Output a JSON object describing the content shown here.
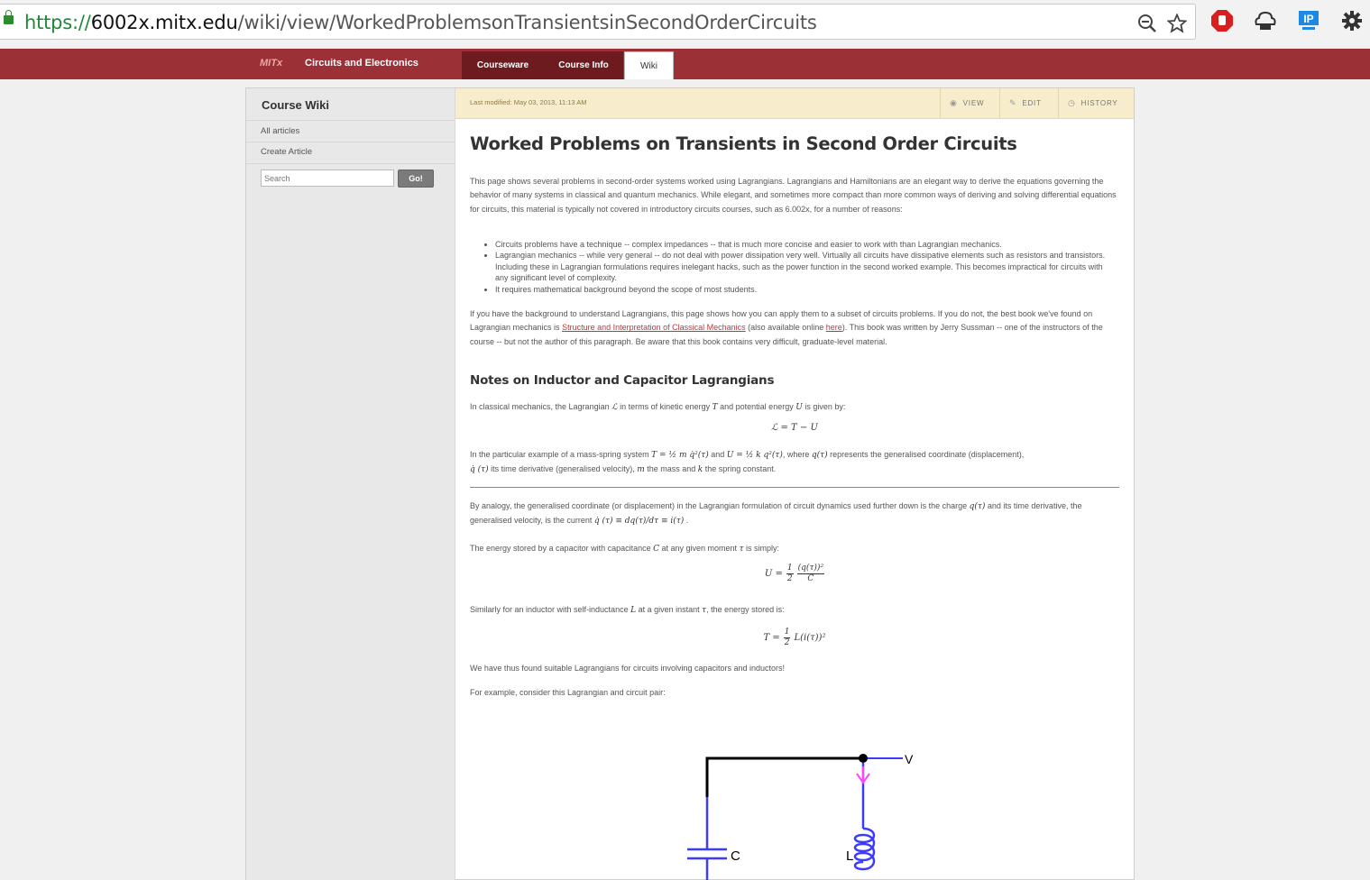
{
  "browser": {
    "url_scheme": "https://",
    "url_host": "6002x.mitx.edu",
    "url_path": "/wiki/view/WorkedProblemsonTransientsinSecondOrderCircuits",
    "ext_ip_label": "IP"
  },
  "header": {
    "brand": "MITx",
    "course_title": "Circuits and Electronics",
    "tabs": [
      "Courseware",
      "Course Info",
      "Wiki"
    ]
  },
  "sidebar": {
    "title": "Course Wiki",
    "links": [
      "All articles",
      "Create Article"
    ],
    "search_placeholder": "Search",
    "go_label": "Go!"
  },
  "toolbar": {
    "last_modified": "Last modified: May 03, 2013, 11:13 AM",
    "view": "VIEW",
    "edit": "EDIT",
    "history": "HISTORY"
  },
  "article": {
    "title": "Worked Problems on Transients in Second Order Circuits",
    "intro": "This page shows several problems in second-order systems worked using Lagrangians. Lagrangians and Hamiltonians are an elegant way to derive the equations governing the behavior of many systems in classical and quantum mechanics. While elegant, and sometimes more compact than more common ways of deriving and solving differential equations for circuits, this material is typically not covered in introductory circuits courses, such as 6.002x, for a number of reasons:",
    "bullets": [
      "Circuits problems have a technique -- complex impedances -- that is much more concise and easier to work with than Lagrangian mechanics.",
      "Lagrangian mechanics -- while very general -- do not deal with power dissipation very well. Virtually all circuits have dissipative elements such as resistors and transistors. Including these in Lagrangian formulations requires inelegant hacks, such as the power function in the second worked example. This becomes impractical for circuits with any significant level of complexity.",
      "It requires mathematical background beyond the scope of most students."
    ],
    "para2_a": "If you have the background to understand Lagrangians, this page shows how you can apply them to a subset of circuits problems. If you do not, the best book we've found on Lagrangian mechanics is ",
    "para2_link1": "Structure and Interpretation of Classical Mechanics",
    "para2_b": " (also available online ",
    "para2_link2": "here",
    "para2_c": "). This book was written by Jerry Sussman -- one of the instructors of the course -- but not the author of this paragraph. Be aware that this book contains very difficult, graduate-level material.",
    "section_title": "Notes on Inductor and Capacitor Lagrangians",
    "lag_a": "In classical mechanics, the Lagrangian ",
    "lag_b": " in terms of kinetic energy ",
    "lag_c": " and potential energy ",
    "lag_d": " is given by:",
    "eq_lagrangian": "ℒ = T − U",
    "mass_a": "In the particular example of a mass-spring system ",
    "mass_eq1": "T = ½ m q̇²(τ)",
    "mass_b": " and ",
    "mass_eq2": "U = ½ k q²(τ)",
    "mass_c": ", where ",
    "mass_q": "q(τ)",
    "mass_d": " represents the generalised coordinate (displacement),",
    "mass_qdot": "q̇ (τ)",
    "mass_e": " its time derivative (generalised velocity), ",
    "mass_m": "m",
    "mass_f": " the mass and ",
    "mass_k": "k",
    "mass_g": " the spring constant.",
    "analogy_a": "By analogy, the generalised coordinate (or displacement) in the Lagrangian formulation of circuit dynamics used further down is the charge ",
    "analogy_q": "q(τ)",
    "analogy_b": " and its time derivative, the generalised velocity, is the current ",
    "analogy_eq": "q̇ (τ) ≡ dq(τ)/dτ ≡ i(τ)",
    "analogy_c": " .",
    "cap_a": "The energy stored by a capacitor with capacitance ",
    "cap_C": "C",
    "cap_b": " at any given moment ",
    "cap_tau": "τ",
    "cap_c": " is simply:",
    "eq_cap_lhs": "U =",
    "eq_cap_half": "1",
    "eq_cap_two": "2",
    "eq_cap_num": "(q(τ))²",
    "eq_cap_den": "C",
    "ind_a": "Similarly for an inductor with self-inductance ",
    "ind_L": "L",
    "ind_b": " at a given instant ",
    "ind_tau": "τ",
    "ind_c": ", the energy stored is:",
    "eq_ind_lhs": "T =",
    "eq_ind_rhs": "L(i(τ))²",
    "found": "We have thus found suitable Lagrangians for circuits involving capacitors and inductors!",
    "example": "For example, consider this Lagrangian and circuit pair:",
    "symbols": {
      "L": "ℒ",
      "T": "T",
      "U": "U"
    }
  },
  "circuit": {
    "label_v": "V",
    "label_c": "C",
    "label_l": "L"
  },
  "colors": {
    "header": "#9b3036",
    "tab_dark": "#6e1b20",
    "modbar": "#f7eccb",
    "wire_blue": "#3b3bff",
    "current_arrow": "#ff44ff"
  }
}
